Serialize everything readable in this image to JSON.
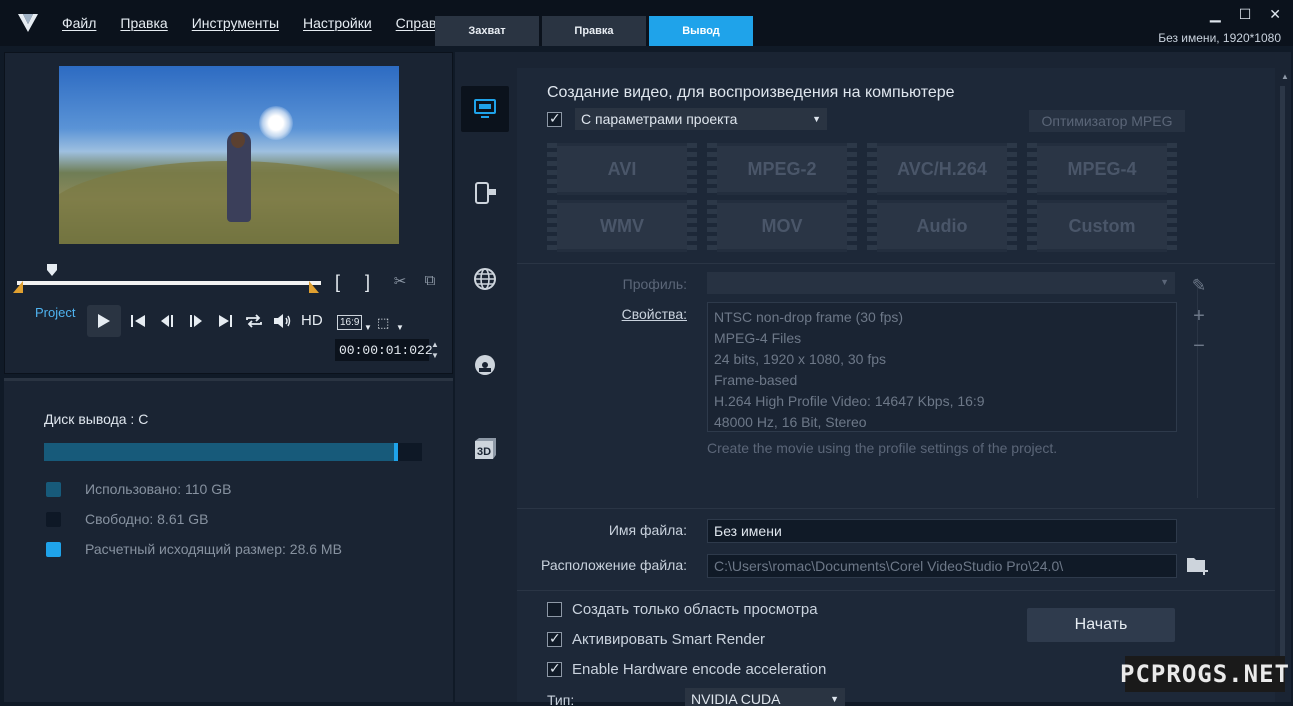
{
  "menu": [
    "Файл",
    "Правка",
    "Инструменты",
    "Настройки",
    "Справка"
  ],
  "tabs": [
    {
      "label": "Захват",
      "active": false
    },
    {
      "label": "Правка",
      "active": false
    },
    {
      "label": "Вывод",
      "active": true
    }
  ],
  "window_controls": {
    "minimize": "▁",
    "maximize": "☐",
    "close": "✕"
  },
  "project_info": "Без имени, 1920*1080",
  "player": {
    "mode_label": "Project",
    "hd_label": "HD",
    "aspect_label": "16:9",
    "timecode": "00:00:01:022",
    "mark_in": "[",
    "mark_out": "]"
  },
  "disk": {
    "title": "Диск вывода : C",
    "used_fraction": 0.927,
    "estimated_fraction": 0.0067,
    "legend": [
      {
        "label": "Использовано:  110 GB",
        "color": "#175a7a"
      },
      {
        "label": "Свободно:  8.61 GB",
        "color": "#0e1826"
      },
      {
        "label": "Расчетный исходящий размер: 28.6 MB",
        "color": "#1fa3ea"
      }
    ]
  },
  "side_icons": [
    "computer-icon",
    "mobile-device-icon",
    "web-globe-icon",
    "dvd-disc-icon",
    "3d-icon"
  ],
  "output": {
    "section_title": "Создание видео, для воспроизведения на компьютере",
    "project_settings_checked": true,
    "project_settings_label": "С параметрами проекта",
    "mpeg_optimizer": "Оптимизатор MPEG",
    "formats": [
      "AVI",
      "MPEG-2",
      "AVC/H.264",
      "MPEG-4",
      "WMV",
      "MOV",
      "Audio",
      "Custom"
    ],
    "profile_label": "Профиль:",
    "properties_label": "Свойства:",
    "properties": [
      "NTSC non-drop frame (30 fps)",
      "MPEG-4 Files",
      "24 bits, 1920 x 1080, 30 fps",
      "Frame-based",
      "H.264 High Profile Video: 14647 Kbps, 16:9",
      "48000 Hz, 16 Bit, Stereo"
    ],
    "properties_desc": "Create the movie using the profile settings of the project.",
    "filename_label": "Имя файла:",
    "filename_value": "Без имени",
    "location_label": "Расположение файла:",
    "location_value": "C:\\Users\\romac\\Documents\\Corel VideoStudio Pro\\24.0\\",
    "options": [
      {
        "label": "Создать только область просмотра",
        "checked": false
      },
      {
        "label": "Активировать Smart Render",
        "checked": true
      },
      {
        "label": "Enable Hardware encode acceleration",
        "checked": true
      }
    ],
    "start_button": "Начать",
    "type_label": "Тип:",
    "type_value": "NVIDIA CUDA"
  },
  "watermark": "PCPROGS.NET"
}
